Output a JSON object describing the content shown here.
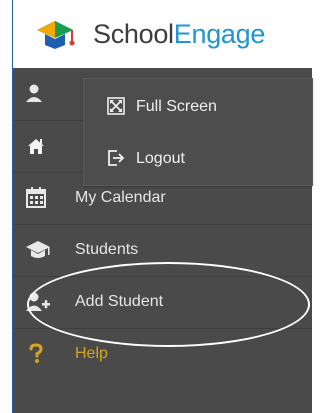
{
  "brand": {
    "name_part1": "School",
    "name_part2": "Engage"
  },
  "sidebar": {
    "items": [
      {
        "label": "",
        "icon": "user-icon"
      },
      {
        "label": "",
        "icon": "home-icon"
      },
      {
        "label": "My Calendar",
        "icon": "calendar-icon"
      },
      {
        "label": "Students",
        "icon": "graduation-cap-icon"
      },
      {
        "label": "Add Student",
        "icon": "add-user-icon"
      },
      {
        "label": "Help",
        "icon": "question-icon"
      }
    ]
  },
  "submenu": {
    "items": [
      {
        "label": "Full Screen",
        "icon": "fullscreen-icon"
      },
      {
        "label": "Logout",
        "icon": "logout-icon"
      }
    ]
  },
  "colors": {
    "sidebar_bg": "#4a4a4a",
    "brand_accent": "#1f95d2",
    "help_text": "#d6a520",
    "text_light": "#e6e6e6"
  }
}
